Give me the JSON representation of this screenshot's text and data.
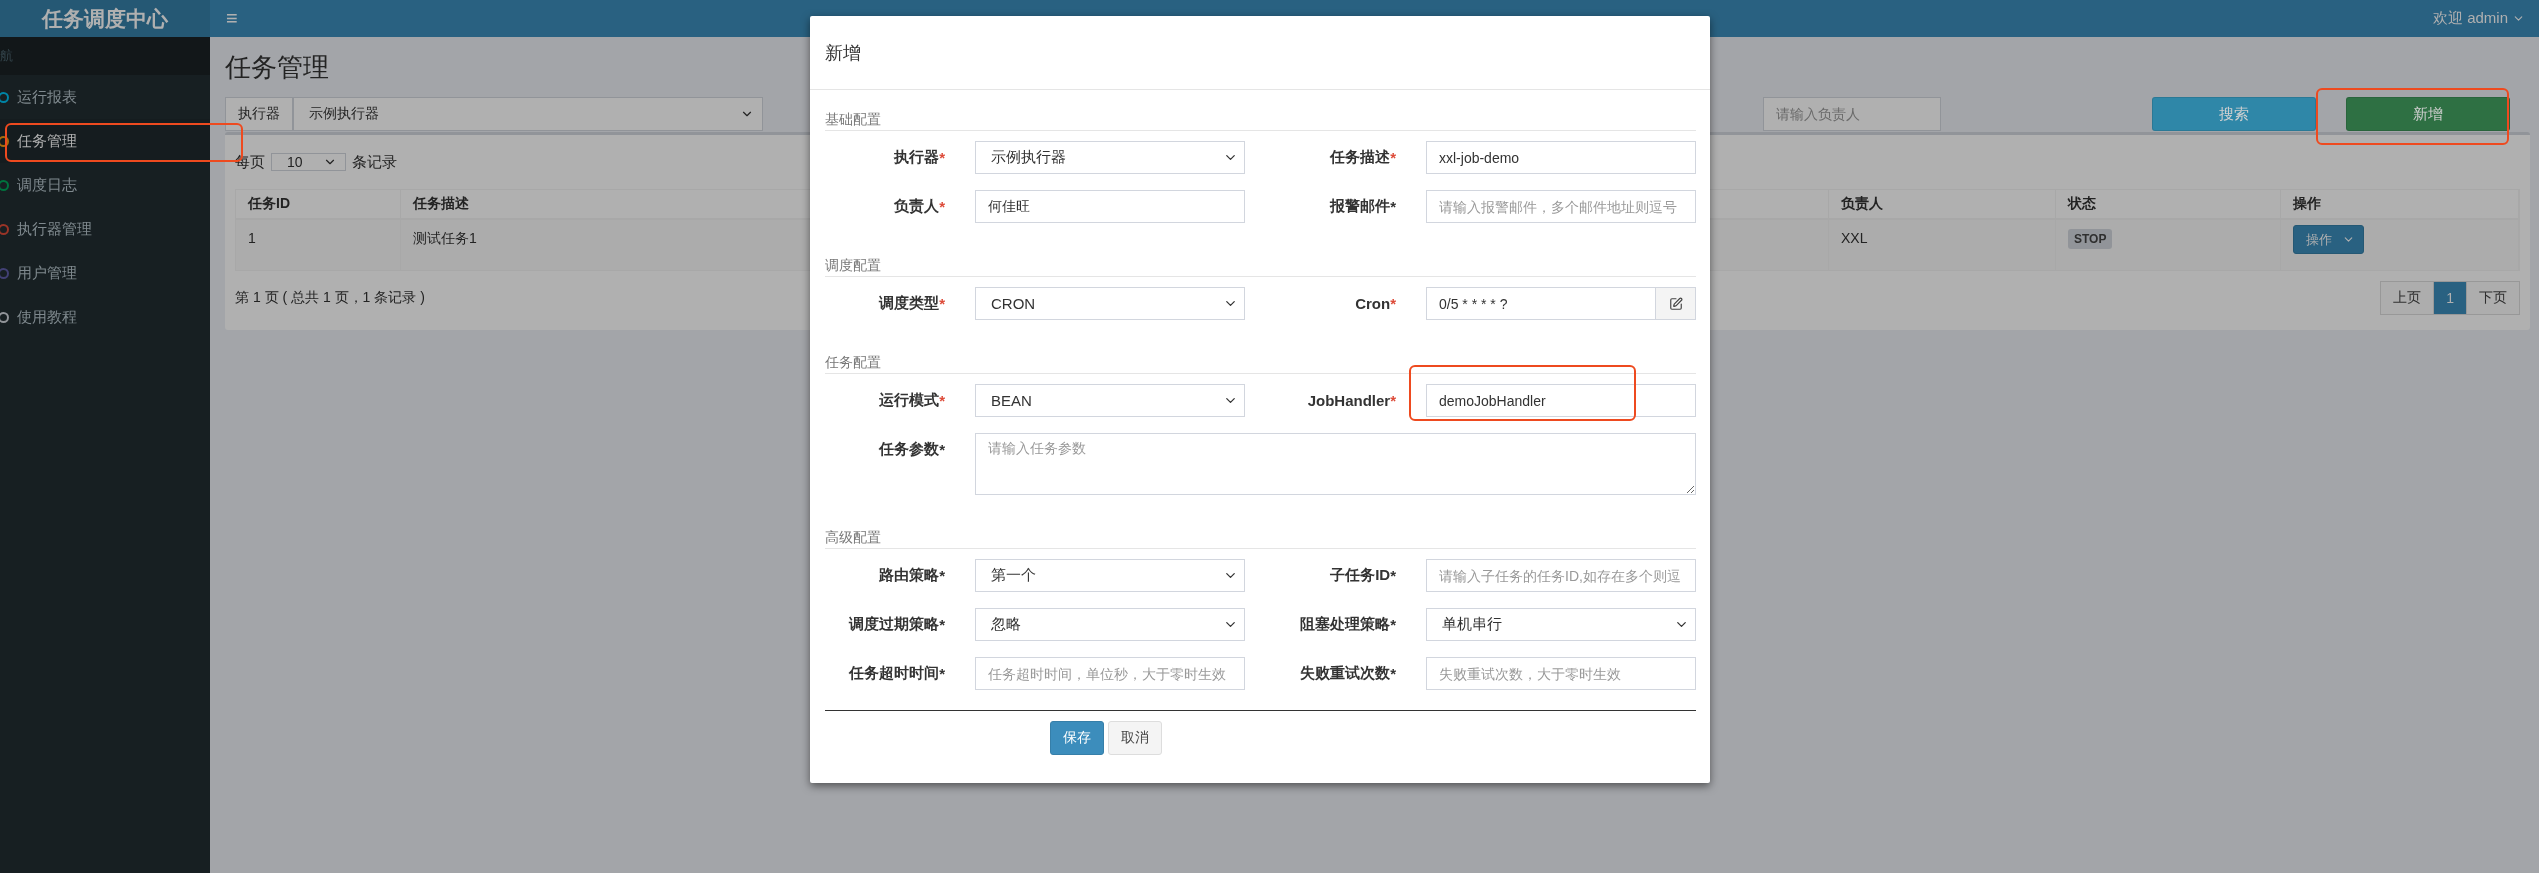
{
  "app": {
    "brand": "任务调度中心",
    "menu_toggle": "≡",
    "user": "欢迎 admin"
  },
  "sidebar": {
    "header": "航",
    "items": [
      {
        "label": "运行报表",
        "color": "#0084a5",
        "selected": false,
        "highlighted": false
      },
      {
        "label": "任务管理",
        "color": "#a86c0c",
        "selected": true,
        "highlighted": true
      },
      {
        "label": "调度日志",
        "color": "#00723e",
        "selected": false,
        "highlighted": false
      },
      {
        "label": "执行器管理",
        "color": "#993427",
        "selected": false,
        "highlighted": false
      },
      {
        "label": "用户管理",
        "color": "#424074",
        "selected": false,
        "highlighted": false
      },
      {
        "label": "使用教程",
        "color": "#919499",
        "selected": false,
        "highlighted": false
      }
    ]
  },
  "page": {
    "title": "任务管理",
    "filter": {
      "executor_label": "执行器",
      "executor_value": "示例执行器",
      "owner_placeholder": "请输入负责人",
      "search_button": "搜索",
      "add_button": "新增",
      "add_highlighted": true
    },
    "page_size": {
      "prefix": "每页",
      "value": "10",
      "suffix": "条记录"
    },
    "table": {
      "columns": [
        "任务ID",
        "任务描述",
        "负责人",
        "状态",
        "操作"
      ],
      "rows": [
        {
          "id": "1",
          "description": "测试任务1",
          "owner": "XXL",
          "status": "STOP",
          "action": "操作"
        }
      ]
    },
    "summary": "第 1 页 ( 总共 1 页，1 条记录 )",
    "pager": [
      {
        "label": "上页",
        "selected": false
      },
      {
        "label": "1",
        "selected": true
      },
      {
        "label": "下页",
        "selected": false
      }
    ]
  },
  "modal": {
    "title": "新增",
    "sections": [
      {
        "title": "基础配置",
        "fields": [
          {
            "label": "执行器",
            "asterisk": "*",
            "asterisk_red": true,
            "kind": "select",
            "value": "示例执行器"
          },
          {
            "label": "任务描述",
            "asterisk": "*",
            "asterisk_red": true,
            "kind": "input",
            "value": "xxl-job-demo"
          },
          {
            "label": "负责人",
            "asterisk": "*",
            "asterisk_red": true,
            "kind": "input",
            "value": "何佳旺"
          },
          {
            "label": "报警邮件",
            "asterisk": "*",
            "asterisk_red": false,
            "kind": "input",
            "placeholder": "请输入报警邮件，多个邮件地址则逗号"
          }
        ]
      },
      {
        "title": "调度配置",
        "fields": [
          {
            "label": "调度类型",
            "asterisk": "*",
            "asterisk_red": true,
            "kind": "select",
            "value": "CRON"
          },
          {
            "label": "Cron",
            "asterisk": "*",
            "asterisk_red": true,
            "kind": "input_button",
            "value": "0/5 * * * * ?"
          }
        ]
      },
      {
        "title": "任务配置",
        "fields": [
          {
            "label": "运行模式",
            "asterisk": "*",
            "asterisk_red": true,
            "kind": "select",
            "value": "BEAN"
          },
          {
            "label": "JobHandler",
            "asterisk": "*",
            "asterisk_red": true,
            "kind": "input",
            "value": "demoJobHandler",
            "highlighted": true
          },
          {
            "label": "任务参数",
            "asterisk": "*",
            "asterisk_red": false,
            "kind": "textarea",
            "placeholder": "请输入任务参数"
          }
        ]
      },
      {
        "title": "高级配置",
        "fields": [
          {
            "label": "路由策略",
            "asterisk": "*",
            "asterisk_red": false,
            "kind": "select",
            "value": "第一个"
          },
          {
            "label": "子任务ID",
            "asterisk": "*",
            "asterisk_red": false,
            "kind": "input",
            "placeholder": "请输入子任务的任务ID,如存在多个则逗"
          },
          {
            "label": "调度过期策略",
            "asterisk": "*",
            "asterisk_red": false,
            "kind": "select",
            "value": "忽略"
          },
          {
            "label": "阻塞处理策略",
            "asterisk": "*",
            "asterisk_red": false,
            "kind": "select",
            "value": "单机串行"
          },
          {
            "label": "任务超时时间",
            "asterisk": "*",
            "asterisk_red": false,
            "kind": "input",
            "placeholder": "任务超时时间，单位秒，大于零时生效"
          },
          {
            "label": "失败重试次数",
            "asterisk": "*",
            "asterisk_red": false,
            "kind": "input",
            "placeholder": "失败重试次数，大于零时生效"
          }
        ]
      }
    ],
    "buttons": [
      {
        "label": "保存",
        "kind": "primary"
      },
      {
        "label": "取消",
        "kind": "default"
      }
    ]
  }
}
